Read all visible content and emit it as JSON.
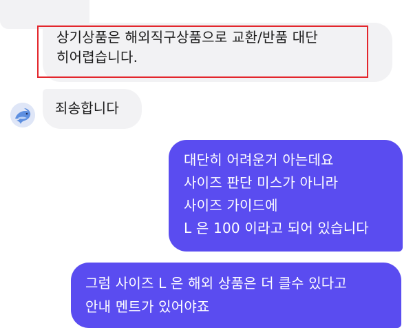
{
  "icons": {
    "avatar": "dolphin-avatar-icon"
  },
  "colors": {
    "incoming_bubble": "#f2f2f4",
    "outgoing_bubble": "#5a4cf0",
    "highlight_border": "#e3262c"
  },
  "messages": {
    "notice": "상기상품은 해외직구상품으로 교환/반품 대단\n히어렵습니다.",
    "sorry": "죄송합니다",
    "reply1": "대단히 어려운거 아는데요\n사이즈 판단 미스가 아니라\n사이즈 가이드에\nL 은 100 이라고 되어 있습니다",
    "reply2": "그럼 사이즈 L 은 해외 상품은 더 클수 있다고\n안내 멘트가 있어야죠"
  }
}
